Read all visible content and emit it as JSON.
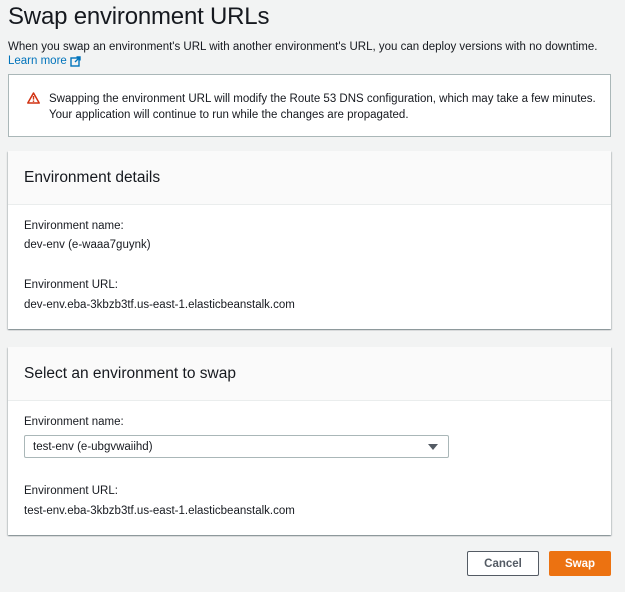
{
  "page": {
    "title": "Swap environment URLs",
    "description": "When you swap an environment's URL with another environment's URL, you can deploy versions with no downtime.",
    "learn_more": "Learn more"
  },
  "alert": {
    "line1": "Swapping the environment URL will modify the Route 53 DNS configuration, which may take a few minutes.",
    "line2": "Your application will continue to run while the changes are propagated."
  },
  "details": {
    "heading": "Environment details",
    "name_label": "Environment name:",
    "name_value": "dev-env (e-waaa7guynk)",
    "url_label": "Environment URL:",
    "url_value": "dev-env.eba-3kbzb3tf.us-east-1.elasticbeanstalk.com"
  },
  "swap_target": {
    "heading": "Select an environment to swap",
    "name_label": "Environment name:",
    "selected": "test-env (e-ubgvwaiihd)",
    "url_label": "Environment URL:",
    "url_value": "test-env.eba-3kbzb3tf.us-east-1.elasticbeanstalk.com"
  },
  "actions": {
    "cancel": "Cancel",
    "swap": "Swap"
  },
  "colors": {
    "primary": "#ec7211",
    "link": "#0073bb",
    "warning": "#d13212"
  },
  "icons": {
    "warning": "warning-triangle-icon",
    "external": "external-link-icon",
    "caret": "caret-down-icon"
  }
}
